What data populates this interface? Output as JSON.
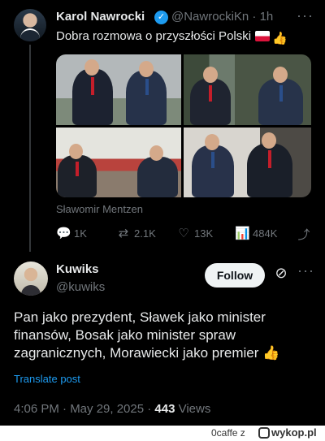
{
  "parent": {
    "author_name": "Karol Nawrocki",
    "author_handle": "@NawrockiKn · 1h",
    "text": "Dobra rozmowa o przyszłości Polski",
    "image_caption": "Sławomir Mentzen",
    "actions": {
      "replies": "1K",
      "reposts": "2.1K",
      "likes": "13K",
      "views": "484K"
    }
  },
  "reply": {
    "author_name": "Kuwiks",
    "author_handle": "@kuwiks",
    "follow_label": "Follow",
    "text": "Pan jako prezydent, Sławek jako minister finansów, Bosak jako minister spraw zagranicznych, Morawiecki jako premier",
    "translate_label": "Translate post",
    "timestamp": "4:06 PM · May 29, 2025 · ",
    "views_count": "443",
    "views_label": " Views"
  },
  "footer": {
    "user": "0caffe z",
    "site": "wykop.pl"
  },
  "colors": {
    "background": "#000000",
    "text_primary": "#e7e9ea",
    "text_secondary": "#71767b",
    "accent": "#1d9bf0"
  },
  "icons": [
    "verified-badge-icon",
    "more-icon",
    "poland-flag-icon",
    "thumbs-up-icon",
    "reply-icon",
    "repost-icon",
    "like-icon",
    "views-icon",
    "share-icon",
    "grok-icon"
  ]
}
